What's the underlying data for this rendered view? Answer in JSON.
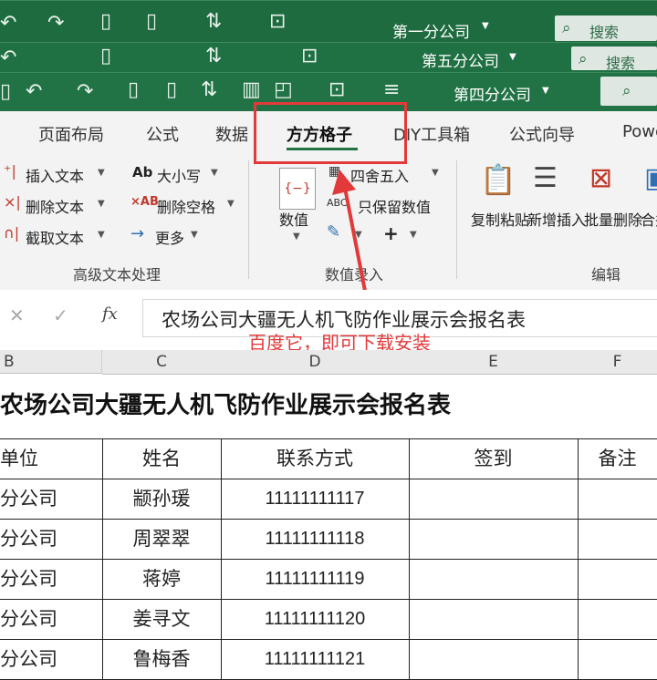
{
  "window_titles": [
    "第一分公司",
    "第五分公司",
    "第四分公司"
  ],
  "search_label": "搜索",
  "tabs": [
    "页面布局",
    "公式",
    "数据",
    "方方格子",
    "DIY工具箱",
    "公式向导",
    "Powe"
  ],
  "active_tab": "方方格子",
  "ribbon": {
    "text_group": {
      "name": "高级文本处理",
      "items": [
        "插入文本",
        "删除文本",
        "截取文本",
        "大小写",
        "删除空格",
        "更多"
      ]
    },
    "number_group": {
      "name": "数值录入",
      "items": [
        "数值",
        "四舍五入",
        "只保留数值"
      ]
    },
    "edit_group": {
      "name": "编辑",
      "items": [
        "复制粘贴",
        "新增插入",
        "批量删除",
        "合并"
      ]
    }
  },
  "formula_bar": {
    "fx": "fx",
    "content": "农场公司大疆无人机飞防作业展示会报名表"
  },
  "annotation": "百度它，即可下载安装",
  "columns": [
    "B",
    "C",
    "D",
    "E",
    "F"
  ],
  "sheet": {
    "title": "农场公司大疆无人机飞防作业展示会报名表",
    "headers": [
      "单位",
      "姓名",
      "联系方式",
      "签到",
      "备注"
    ],
    "rows": [
      [
        "分公司",
        "颛孙瑗",
        "11111111117",
        "",
        ""
      ],
      [
        "分公司",
        "周翠翠",
        "11111111118",
        "",
        ""
      ],
      [
        "分公司",
        "蒋婷",
        "11111111119",
        "",
        ""
      ],
      [
        "分公司",
        "姜寻文",
        "11111111120",
        "",
        ""
      ],
      [
        "分公司",
        "鲁梅香",
        "11111111121",
        "",
        ""
      ]
    ]
  },
  "colors": {
    "excel_green": "#217346",
    "highlight_red": "#e23a3a"
  }
}
